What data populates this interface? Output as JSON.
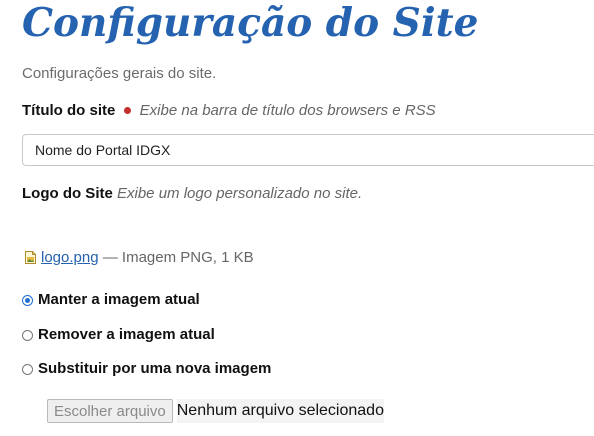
{
  "page": {
    "title": "Configuração do Site",
    "description": "Configurações gerais do site."
  },
  "site_title_field": {
    "label": "Título do site",
    "help": "Exibe na barra de título dos browsers e RSS",
    "value": "Nome do Portal IDGX",
    "required": true
  },
  "logo_field": {
    "label": "Logo do Site",
    "help": "Exibe um logo personalizado no site.",
    "current_file": {
      "icon": "image-file-icon",
      "name": "logo.png",
      "info": "— Imagem PNG, 1 KB"
    },
    "options": [
      {
        "label": "Manter a imagem atual",
        "checked": true
      },
      {
        "label": "Remover a imagem atual",
        "checked": false
      },
      {
        "label": "Substituir por uma nova imagem",
        "checked": false
      }
    ],
    "file_picker": {
      "button_label": "Escolher arquivo",
      "status": "Nenhum arquivo selecionado"
    }
  },
  "colors": {
    "title": "#2563b0",
    "required": "#c4302b",
    "link": "#2563b0",
    "radio_checked": "#1f6fd6"
  }
}
